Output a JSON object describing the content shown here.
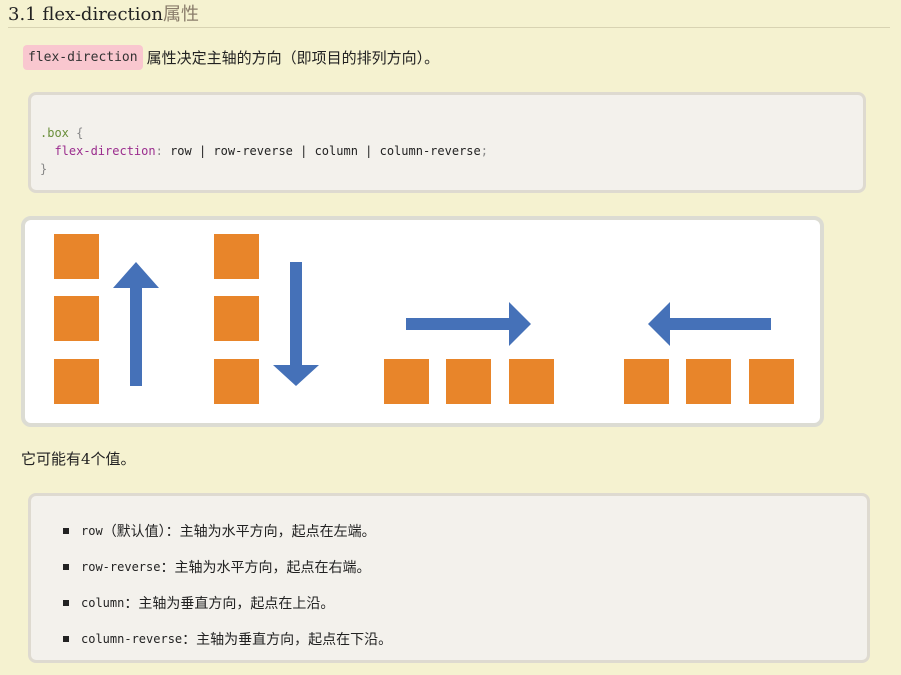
{
  "heading": {
    "prefix": "3.1 flex-direction",
    "suffix": "属性"
  },
  "intro": {
    "code": "flex-direction",
    "text": "属性决定主轴的方向（即项目的排列方向）。"
  },
  "code": {
    "selector": ".box",
    "open_brace": "{",
    "property": "flex-direction",
    "colon": ":",
    "value": "row | row-reverse | column | column-reverse",
    "semicolon": ";",
    "close_brace": "}"
  },
  "diagram": {
    "box_color": "#e8852a",
    "arrow_color": "#4571b8",
    "groups": [
      "column-reverse",
      "column",
      "row",
      "row-reverse"
    ]
  },
  "paragraph": "它可能有4个值。",
  "values_list": [
    {
      "term": "row",
      "desc": "（默认值）：主轴为水平方向，起点在左端。"
    },
    {
      "term": "row-reverse",
      "desc": "：主轴为水平方向，起点在右端。"
    },
    {
      "term": "column",
      "desc": "：主轴为垂直方向，起点在上沿。"
    },
    {
      "term": "column-reverse",
      "desc": "：主轴为垂直方向，起点在下沿。"
    }
  ]
}
